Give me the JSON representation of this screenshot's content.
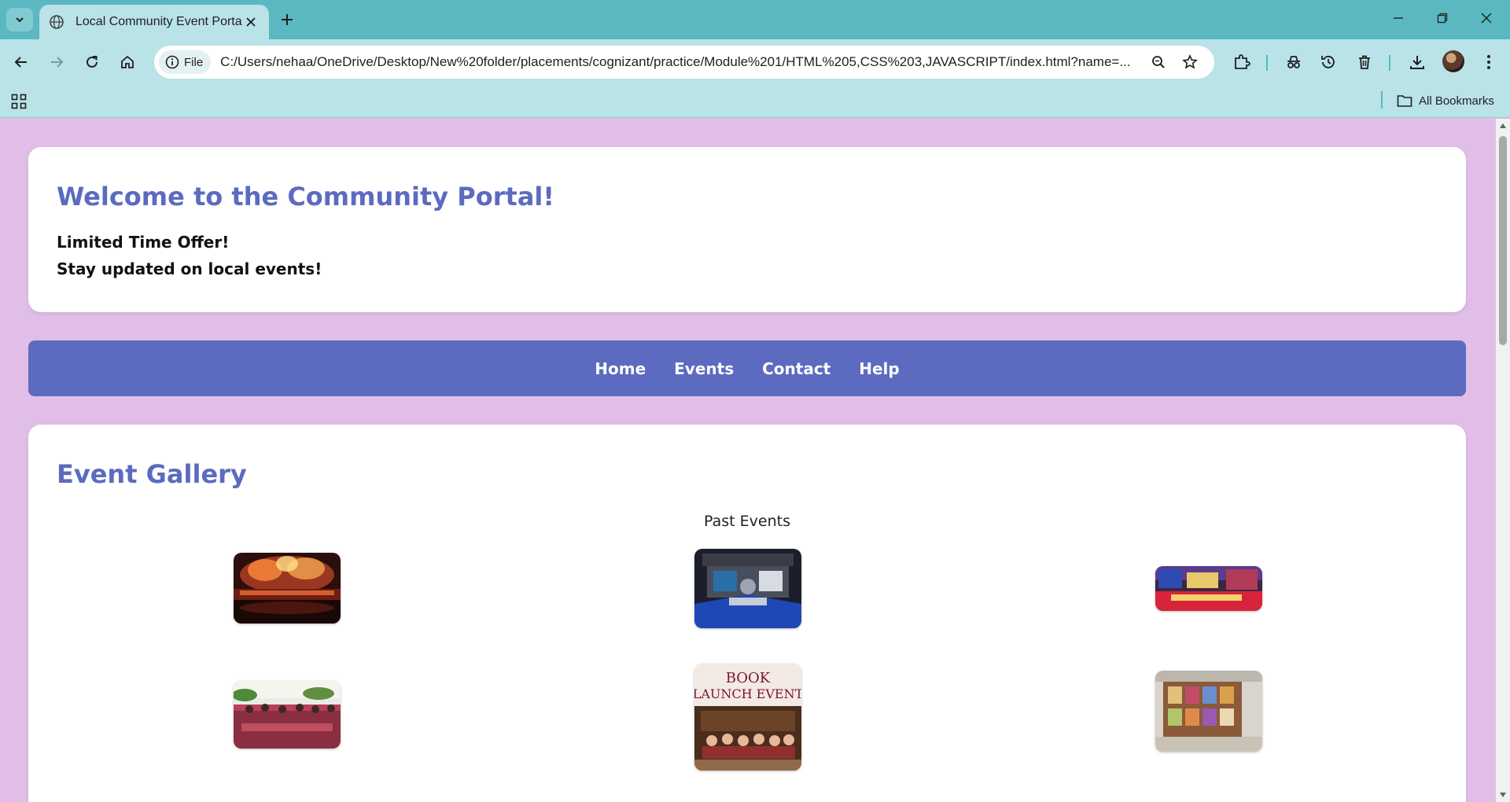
{
  "browser": {
    "tab_title": "Local Community Event Portal",
    "site_chip_label": "File",
    "url": "C:/Users/nehaa/OneDrive/Desktop/New%20folder/placements/cognizant/practice/Module%201/HTML%205,CSS%203,JAVASCRIPT/index.html?name=...",
    "all_bookmarks_label": "All Bookmarks",
    "accent": "#5bb8c1",
    "toolbar_bg": "#b9e3e7"
  },
  "header": {
    "title": "Welcome to the Community Portal!",
    "line1": "Limited Time Offer!",
    "line2": "Stay updated on local events!"
  },
  "nav": {
    "items": [
      "Home",
      "Events",
      "Contact",
      "Help"
    ],
    "bg": "#5c6bc0"
  },
  "gallery": {
    "title": "Event Gallery",
    "caption": "Past Events",
    "images": [
      {
        "name": "concert-fireworks-image",
        "subject": "concert fireworks"
      },
      {
        "name": "exhibition-booth-image",
        "subject": "exhibition booth"
      },
      {
        "name": "craft-market-image",
        "subject": "craft market stall"
      },
      {
        "name": "festival-crowd-image",
        "subject": "festival crowd"
      },
      {
        "name": "book-launch-image",
        "subject": "book launch event",
        "sign_text": "BOOK LAUNCH EVENT"
      },
      {
        "name": "art-display-image",
        "subject": "art display boards"
      }
    ]
  },
  "colors": {
    "page_bg": "#e1bee7",
    "heading": "#5c6bc0",
    "card_bg": "#ffffff"
  }
}
